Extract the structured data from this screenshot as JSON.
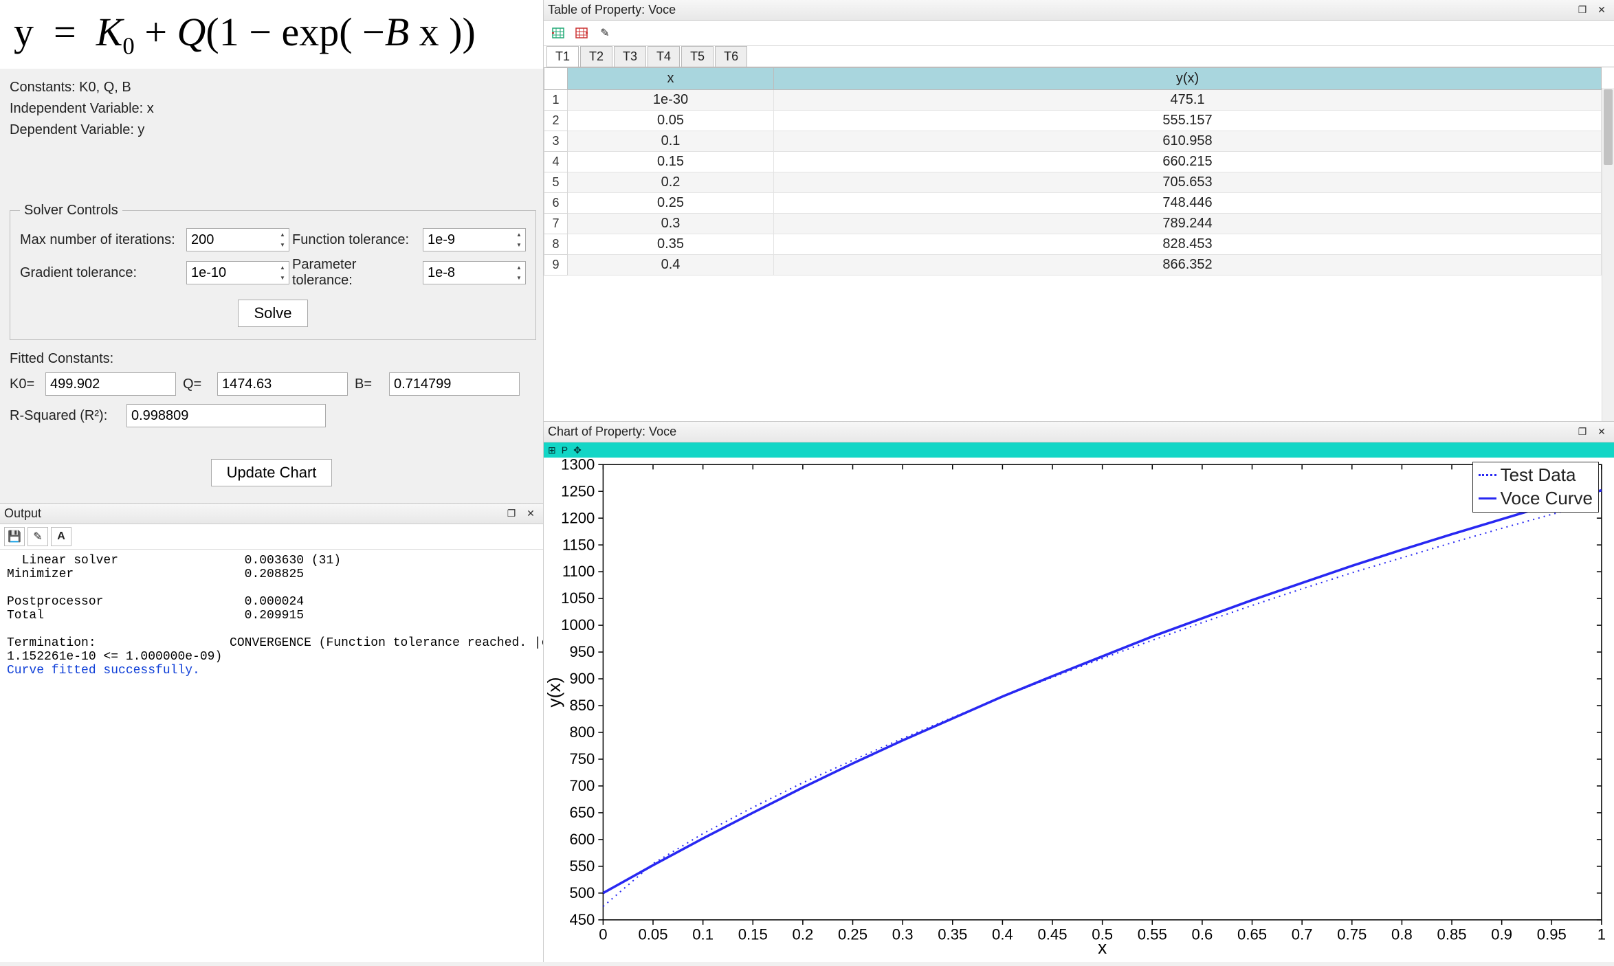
{
  "equation": "y  =  K₀ + Q(1 − exp( −B x ))",
  "vars": {
    "constants_label": "Constants: K0, Q, B",
    "independent_label": "Independent Variable: x",
    "dependent_label": "Dependent Variable: y"
  },
  "solver": {
    "legend": "Solver Controls",
    "max_iter_label": "Max number of iterations:",
    "max_iter": "200",
    "func_tol_label": "Function tolerance:",
    "func_tol": "1e-9",
    "grad_tol_label": "Gradient tolerance:",
    "grad_tol": "1e-10",
    "param_tol_label": "Parameter tolerance:",
    "param_tol": "1e-8",
    "solve_btn": "Solve"
  },
  "fitted": {
    "header": "Fitted Constants:",
    "k0_label": "K0=",
    "k0": "499.902",
    "q_label": "Q=",
    "q": "1474.63",
    "b_label": "B=",
    "b": "0.714799",
    "rsq_label": "R-Squared (R²):",
    "rsq": "0.998809",
    "update_btn": "Update Chart"
  },
  "output": {
    "title": "Output",
    "text_pre": "  Linear solver                 0.003630 (31)\nMinimizer                       0.208825\n\nPostprocessor                   0.000024\nTotal                           0.209915\n\nTermination:                  CONVERGENCE (Function tolerance reached. |cost_change|/cost:\n1.152261e-10 <= 1.000000e-09)",
    "text_ok": "Curve fitted successfully."
  },
  "table": {
    "title": "Table of Property: Voce",
    "tabs": [
      "T1",
      "T2",
      "T3",
      "T4",
      "T5",
      "T6"
    ],
    "active_tab": 0,
    "col_x": "x",
    "col_y": "y(x)",
    "rows": [
      {
        "n": "1",
        "x": "1e-30",
        "y": "475.1"
      },
      {
        "n": "2",
        "x": "0.05",
        "y": "555.157"
      },
      {
        "n": "3",
        "x": "0.1",
        "y": "610.958"
      },
      {
        "n": "4",
        "x": "0.15",
        "y": "660.215"
      },
      {
        "n": "5",
        "x": "0.2",
        "y": "705.653"
      },
      {
        "n": "6",
        "x": "0.25",
        "y": "748.446"
      },
      {
        "n": "7",
        "x": "0.3",
        "y": "789.244"
      },
      {
        "n": "8",
        "x": "0.35",
        "y": "828.453"
      },
      {
        "n": "9",
        "x": "0.4",
        "y": "866.352"
      }
    ]
  },
  "chart": {
    "title": "Chart of Property: Voce",
    "toolstrip_label": "P",
    "legend_test": "Test Data",
    "legend_voce": "Voce Curve",
    "ylabel": "y(x)",
    "xlabel": "x",
    "x_ticks": [
      "0",
      "0.05",
      "0.1",
      "0.15",
      "0.2",
      "0.25",
      "0.3",
      "0.35",
      "0.4",
      "0.45",
      "0.5",
      "0.55",
      "0.6",
      "0.65",
      "0.7",
      "0.75",
      "0.8",
      "0.85",
      "0.9",
      "0.95",
      "1"
    ],
    "y_ticks": [
      "450",
      "500",
      "550",
      "600",
      "650",
      "700",
      "750",
      "800",
      "850",
      "900",
      "950",
      "1000",
      "1050",
      "1100",
      "1150",
      "1200",
      "1250",
      "1300"
    ]
  },
  "chart_data": {
    "type": "line",
    "xlabel": "x",
    "ylabel": "y(x)",
    "xlim": [
      0,
      1
    ],
    "ylim": [
      450,
      1300
    ],
    "series": [
      {
        "name": "Test Data",
        "style": "dotted",
        "x": [
          0,
          0.05,
          0.1,
          0.15,
          0.2,
          0.25,
          0.3,
          0.35,
          0.4,
          0.45,
          0.5,
          0.55,
          0.6,
          0.65,
          0.7,
          0.75,
          0.8,
          0.85,
          0.9,
          0.95,
          1
        ],
        "y": [
          475,
          555,
          611,
          660,
          706,
          748,
          789,
          828,
          866,
          903,
          938,
          972,
          1005,
          1037,
          1068,
          1098,
          1126,
          1154,
          1181,
          1207,
          1232
        ]
      },
      {
        "name": "Voce Curve",
        "style": "solid",
        "x": [
          0,
          0.05,
          0.1,
          0.15,
          0.2,
          0.25,
          0.3,
          0.35,
          0.4,
          0.45,
          0.5,
          0.55,
          0.6,
          0.65,
          0.7,
          0.75,
          0.8,
          0.85,
          0.9,
          0.95,
          1
        ],
        "y": [
          500,
          552,
          602,
          650,
          697,
          742,
          785,
          826,
          867,
          905,
          942,
          979,
          1013,
          1047,
          1079,
          1111,
          1141,
          1170,
          1198,
          1226,
          1252
        ]
      }
    ]
  }
}
